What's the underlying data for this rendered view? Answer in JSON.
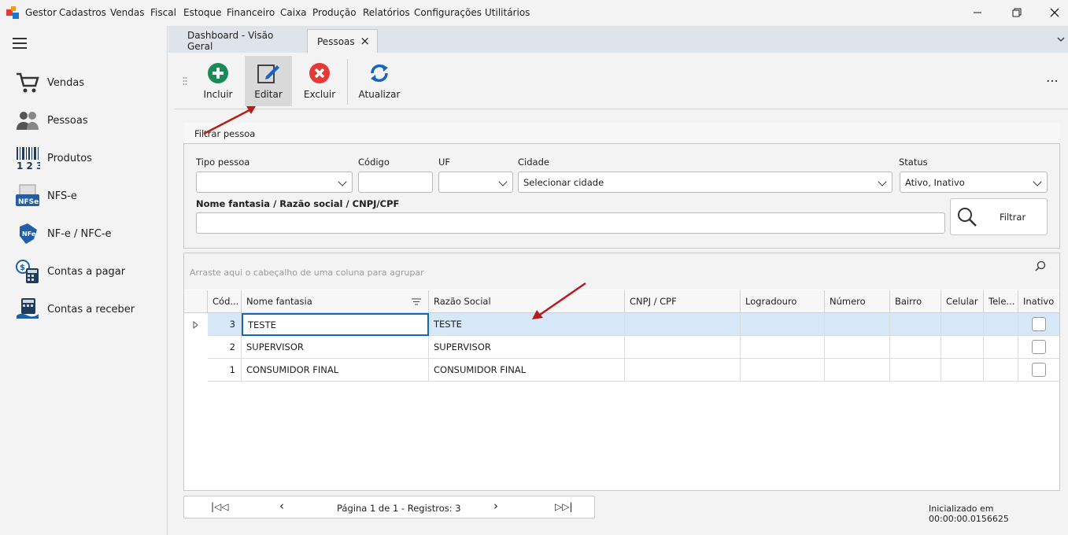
{
  "menu": {
    "items": [
      "Gestor",
      "Cadastros",
      "Vendas",
      "Fiscal",
      "Estoque",
      "Financeiro",
      "Caixa",
      "Produção",
      "Relatórios",
      "Configurações",
      "Utilitários"
    ]
  },
  "window": {
    "minimize_icon": "minimize-icon",
    "restore_icon": "restore-icon",
    "close_icon": "close-icon"
  },
  "sidebar": {
    "items": [
      {
        "label": "Vendas",
        "icon": "cart-icon"
      },
      {
        "label": "Pessoas",
        "icon": "people-icon"
      },
      {
        "label": "Produtos",
        "icon": "barcode-icon"
      },
      {
        "label": "NFS-e",
        "icon": "nfse-icon"
      },
      {
        "label": "NF-e / NFC-e",
        "icon": "nfe-icon"
      },
      {
        "label": "Contas a pagar",
        "icon": "calculator-icon"
      },
      {
        "label": "Contas a receber",
        "icon": "cash-icon"
      }
    ]
  },
  "tabs": [
    {
      "label": "Dashboard - Visão Geral"
    },
    {
      "label": "Pessoas",
      "close": "×"
    }
  ],
  "toolbar": {
    "incluir": "Incluir",
    "editar": "Editar",
    "excluir": "Excluir",
    "atualizar": "Atualizar",
    "more": "⋯"
  },
  "filter": {
    "title": "Filtrar pessoa",
    "tipo_label": "Tipo pessoa",
    "tipo_value": "",
    "codigo_label": "Código",
    "codigo_value": "",
    "uf_label": "UF",
    "uf_value": "",
    "cidade_label": "Cidade",
    "cidade_placeholder": "Selecionar cidade",
    "status_label": "Status",
    "status_value": "Ativo, Inativo",
    "nome_label": "Nome fantasia / Razão social / CNPJ/CPF",
    "nome_value": "",
    "button": "Filtrar"
  },
  "grid": {
    "group_hint": "Arraste aqui o cabeçalho de uma coluna para agrupar",
    "columns": [
      "Cód...",
      "Nome fantasia",
      "Razão Social",
      "CNPJ / CPF",
      "Logradouro",
      "Número",
      "Bairro",
      "Celular",
      "Tele...",
      "Inativo"
    ],
    "rows": [
      {
        "codigo": "3",
        "nome": "TESTE",
        "razao": "TESTE",
        "inativo": false
      },
      {
        "codigo": "2",
        "nome": "SUPERVISOR",
        "razao": "SUPERVISOR",
        "inativo": false
      },
      {
        "codigo": "1",
        "nome": "CONSUMIDOR FINAL",
        "razao": "CONSUMIDOR FINAL",
        "inativo": false
      }
    ]
  },
  "pager": {
    "first": "|◁◁",
    "prev": "‹",
    "info": "Página 1 de 1 - Registros: 3",
    "next": "›",
    "last": "▷▷|"
  },
  "status": {
    "text": "Inicializado em 00:00:00.0156625"
  },
  "colors": {
    "accent": "#1565c0",
    "green": "#1b8a5a",
    "red": "#e53935",
    "arrow": "#b71c1c",
    "selected_row": "#d6e8f8"
  }
}
